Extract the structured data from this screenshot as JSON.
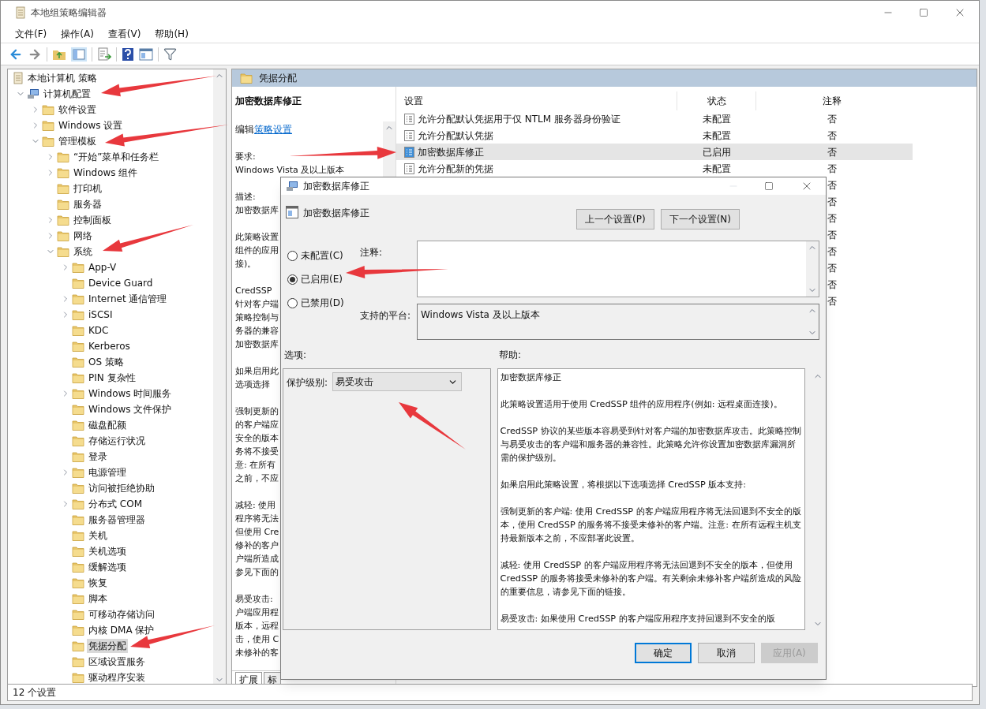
{
  "window": {
    "title": "本地组策略编辑器"
  },
  "menu": [
    "文件(F)",
    "操作(A)",
    "查看(V)",
    "帮助(H)"
  ],
  "tree": {
    "label": "本地计算机 策略",
    "kind": "doc",
    "selected": false,
    "children": [
      {
        "label": "计算机配置",
        "kind": "computer",
        "expanded": true,
        "selected": false,
        "children": [
          {
            "label": "软件设置",
            "kind": "folder",
            "expanded": false,
            "selected": false
          },
          {
            "label": "Windows 设置",
            "kind": "folder",
            "expanded": false,
            "selected": false
          },
          {
            "label": "管理模板",
            "kind": "folder",
            "expanded": true,
            "selected": false,
            "children": [
              {
                "label": "“开始”菜单和任务栏",
                "kind": "folder",
                "expanded": false,
                "selected": false
              },
              {
                "label": "Windows 组件",
                "kind": "folder",
                "expanded": false,
                "selected": false
              },
              {
                "label": "打印机",
                "kind": "folder",
                "selected": false
              },
              {
                "label": "服务器",
                "kind": "folder",
                "selected": false
              },
              {
                "label": "控制面板",
                "kind": "folder",
                "expanded": false,
                "selected": false
              },
              {
                "label": "网络",
                "kind": "folder",
                "expanded": false,
                "selected": false
              },
              {
                "label": "系统",
                "kind": "folder",
                "expanded": true,
                "selected": false,
                "children": [
                  {
                    "label": "App-V",
                    "kind": "folder",
                    "expanded": false,
                    "selected": false
                  },
                  {
                    "label": "Device Guard",
                    "kind": "folder",
                    "selected": false
                  },
                  {
                    "label": "Internet 通信管理",
                    "kind": "folder",
                    "expanded": false,
                    "selected": false
                  },
                  {
                    "label": "iSCSI",
                    "kind": "folder",
                    "expanded": false,
                    "selected": false
                  },
                  {
                    "label": "KDC",
                    "kind": "folder",
                    "selected": false
                  },
                  {
                    "label": "Kerberos",
                    "kind": "folder",
                    "selected": false
                  },
                  {
                    "label": "OS 策略",
                    "kind": "folder",
                    "selected": false
                  },
                  {
                    "label": "PIN 复杂性",
                    "kind": "folder",
                    "selected": false
                  },
                  {
                    "label": "Windows 时间服务",
                    "kind": "folder",
                    "expanded": false,
                    "selected": false
                  },
                  {
                    "label": "Windows 文件保护",
                    "kind": "folder",
                    "selected": false
                  },
                  {
                    "label": "磁盘配额",
                    "kind": "folder",
                    "selected": false
                  },
                  {
                    "label": "存储运行状况",
                    "kind": "folder",
                    "selected": false
                  },
                  {
                    "label": "登录",
                    "kind": "folder",
                    "selected": false
                  },
                  {
                    "label": "电源管理",
                    "kind": "folder",
                    "expanded": false,
                    "selected": false
                  },
                  {
                    "label": "访问被拒绝协助",
                    "kind": "folder",
                    "selected": false
                  },
                  {
                    "label": "分布式 COM",
                    "kind": "folder",
                    "expanded": false,
                    "selected": false
                  },
                  {
                    "label": "服务器管理器",
                    "kind": "folder",
                    "selected": false
                  },
                  {
                    "label": "关机",
                    "kind": "folder",
                    "selected": false
                  },
                  {
                    "label": "关机选项",
                    "kind": "folder",
                    "selected": false
                  },
                  {
                    "label": "缓解选项",
                    "kind": "folder",
                    "selected": false
                  },
                  {
                    "label": "恢复",
                    "kind": "folder",
                    "selected": false
                  },
                  {
                    "label": "脚本",
                    "kind": "folder",
                    "selected": false
                  },
                  {
                    "label": "可移动存储访问",
                    "kind": "folder",
                    "selected": false
                  },
                  {
                    "label": "内核 DMA 保护",
                    "kind": "folder",
                    "selected": false
                  },
                  {
                    "label": "凭据分配",
                    "kind": "folder",
                    "selected": true
                  },
                  {
                    "label": "区域设置服务",
                    "kind": "folder",
                    "selected": false
                  },
                  {
                    "label": "驱动程序安装",
                    "kind": "folder",
                    "selected": false
                  }
                ]
              }
            ]
          }
        ]
      }
    ]
  },
  "panel": {
    "title": "凭据分配",
    "description": {
      "heading": "加密数据库修正",
      "edit_prefix": "编辑",
      "edit_link": "策略设置",
      "paragraphs": [
        [
          "要求:",
          "Windows Vista 及以上版本"
        ],
        [
          "描述:",
          "加密数据库"
        ],
        [
          "此策略设置",
          "组件的应用",
          "接)。"
        ],
        [
          "CredSSP",
          "针对客户端",
          "策略控制与",
          "务器的兼容",
          "加密数据库"
        ],
        [
          "如果启用此",
          "选项选择"
        ],
        [
          "强制更新的",
          "的客户端应",
          "安全的版本",
          "务将不接受",
          "意: 在所有",
          "之前，不应"
        ],
        [
          "减轻: 使用",
          "程序将无法",
          "但使用 Cre",
          "修补的客户",
          "户端所造成",
          "参见下面的"
        ],
        [
          "易受攻击:",
          "户端应用程",
          "版本，远程",
          "击，使用 C",
          "未修补的客"
        ]
      ]
    },
    "tabs": [
      {
        "label": "扩展",
        "selected": true
      },
      {
        "label": "标",
        "selected": false
      }
    ]
  },
  "list": {
    "columns": [
      "设置",
      "状态",
      "注释"
    ],
    "rows": [
      {
        "name": "允许分配默认凭据用于仅 NTLM 服务器身份验证",
        "state": "未配置",
        "note": "否",
        "selected": false
      },
      {
        "name": "允许分配默认凭据",
        "state": "未配置",
        "note": "否",
        "selected": false
      },
      {
        "name": "加密数据库修正",
        "state": "已启用",
        "note": "否",
        "selected": true
      },
      {
        "name": "允许分配新的凭据",
        "state": "未配置",
        "note": "否",
        "selected": false
      },
      {
        "note": "否",
        "selected": false
      },
      {
        "note": "否",
        "selected": false
      },
      {
        "note": "否",
        "selected": false
      },
      {
        "note": "否",
        "selected": false
      },
      {
        "note": "否",
        "selected": false
      },
      {
        "note": "否",
        "selected": false
      },
      {
        "note": "否",
        "selected": false
      },
      {
        "note": "否",
        "selected": false
      }
    ]
  },
  "status_bar": "12 个设置",
  "dialog": {
    "title": "加密数据库修正",
    "heading": "加密数据库修正",
    "prev_button": "上一个设置(P)",
    "next_button": "下一个设置(N)",
    "radios": [
      {
        "label": "未配置(C)",
        "selected": false
      },
      {
        "label": "已启用(E)",
        "selected": true
      },
      {
        "label": "已禁用(D)",
        "selected": false
      }
    ],
    "comment_label": "注释:",
    "platform_label": "支持的平台:",
    "platform": "Windows Vista 及以上版本",
    "options_label": "选项:",
    "help_label": "帮助:",
    "option": {
      "label": "保护级别:",
      "value": "易受攻击"
    },
    "help": [
      "加密数据库修正",
      "此策略设置适用于使用 CredSSP 组件的应用程序(例如: 远程桌面连接)。",
      "CredSSP 协议的某些版本容易受到针对客户端的加密数据库攻击。此策略控制与易受攻击的客户端和服务器的兼容性。此策略允许你设置加密数据库漏洞所需的保护级别。",
      "如果启用此策略设置，将根据以下选项选择 CredSSP 版本支持:",
      "强制更新的客户端: 使用 CredSSP 的客户端应用程序将无法回退到不安全的版本，使用 CredSSP 的服务将不接受未修补的客户端。注意: 在所有远程主机支持最新版本之前，不应部署此设置。",
      "减轻: 使用 CredSSP 的客户端应用程序将无法回退到不安全的版本，但使用 CredSSP 的服务将接受未修补的客户端。有关剩余未修补客户端所造成的风险的重要信息，请参见下面的链接。",
      "易受攻击: 如果使用 CredSSP 的客户端应用程序支持回退到不安全的版"
    ],
    "buttons": [
      {
        "label": "确定",
        "kind": "default"
      },
      {
        "label": "取消",
        "kind": "normal"
      },
      {
        "label": "应用(A)",
        "kind": "disabled"
      }
    ]
  }
}
